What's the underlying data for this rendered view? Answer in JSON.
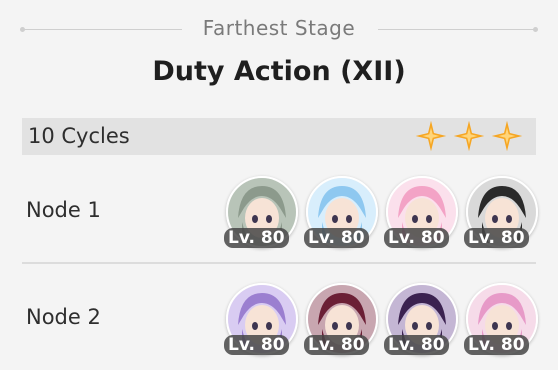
{
  "header": {
    "subtitle": "Farthest Stage",
    "title": "Duty Action (XII)"
  },
  "cycles": {
    "label": "10 Cycles",
    "stars": 3,
    "star_color": "#f6a623"
  },
  "nodes": [
    {
      "label": "Node 1",
      "characters": [
        {
          "level": "Lv. 80",
          "hair": "#8c9a8c",
          "bg": "#b8c4b8"
        },
        {
          "level": "Lv. 80",
          "hair": "#8ec8f0",
          "bg": "#d8eefc"
        },
        {
          "level": "Lv. 80",
          "hair": "#f3a3c6",
          "bg": "#fbe0ec"
        },
        {
          "level": "Lv. 80",
          "hair": "#2a2a2a",
          "bg": "#d9d9d9"
        }
      ]
    },
    {
      "label": "Node 2",
      "characters": [
        {
          "level": "Lv. 80",
          "hair": "#9b7fd0",
          "bg": "#d9ccf2"
        },
        {
          "level": "Lv. 80",
          "hair": "#6b1f35",
          "bg": "#c8a6b0"
        },
        {
          "level": "Lv. 80",
          "hair": "#3b2250",
          "bg": "#c4b6d4"
        },
        {
          "level": "Lv. 80",
          "hair": "#e79ac8",
          "bg": "#f6dbe9"
        }
      ]
    }
  ]
}
